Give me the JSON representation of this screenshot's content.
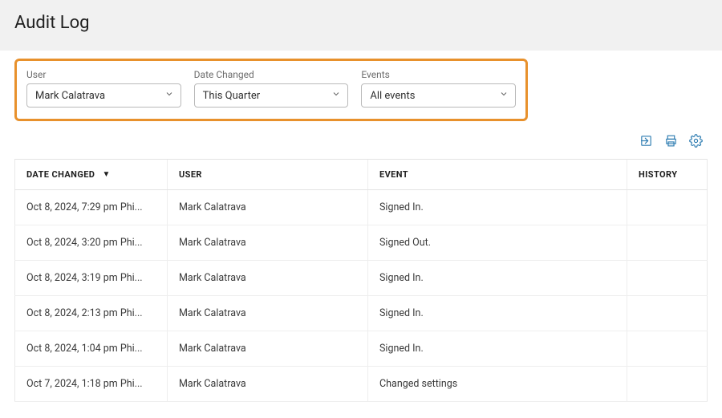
{
  "page": {
    "title": "Audit Log"
  },
  "filters": {
    "user": {
      "label": "User",
      "value": "Mark Calatrava"
    },
    "date": {
      "label": "Date Changed",
      "value": "This Quarter"
    },
    "events": {
      "label": "Events",
      "value": "All events"
    }
  },
  "columns": {
    "date": "DATE CHANGED",
    "user": "USER",
    "event": "EVENT",
    "history": "HISTORY"
  },
  "rows": [
    {
      "date": "Oct 8, 2024, 7:29 pm Phi...",
      "user": "Mark Calatrava",
      "event": "Signed In.",
      "history": ""
    },
    {
      "date": "Oct 8, 2024, 3:20 pm Phi...",
      "user": "Mark Calatrava",
      "event": "Signed Out.",
      "history": ""
    },
    {
      "date": "Oct 8, 2024, 3:19 pm Phi...",
      "user": "Mark Calatrava",
      "event": "Signed In.",
      "history": ""
    },
    {
      "date": "Oct 8, 2024, 2:13 pm Phi...",
      "user": "Mark Calatrava",
      "event": "Signed In.",
      "history": ""
    },
    {
      "date": "Oct 8, 2024, 1:04 pm Phi...",
      "user": "Mark Calatrava",
      "event": "Signed In.",
      "history": ""
    },
    {
      "date": "Oct 7, 2024, 1:18 pm Phi...",
      "user": "Mark Calatrava",
      "event": "Changed settings",
      "history": ""
    }
  ]
}
